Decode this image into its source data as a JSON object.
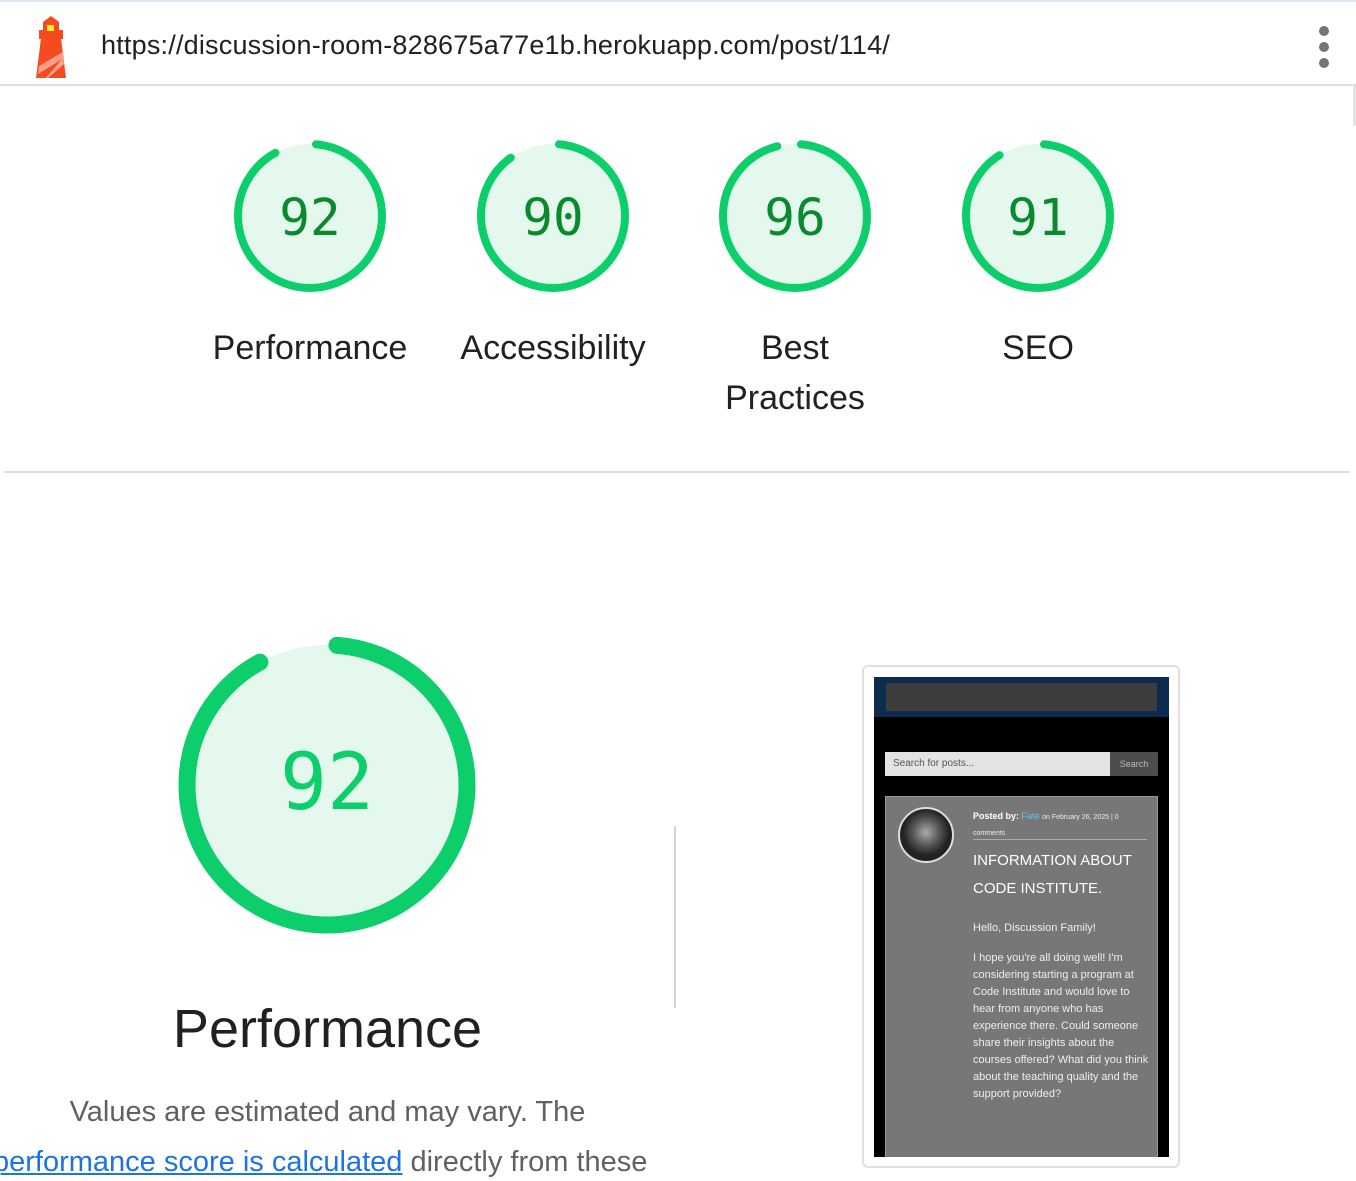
{
  "header": {
    "url": "https://discussion-room-828675a77e1b.herokuapp.com/post/114/"
  },
  "scores": [
    {
      "value": 92,
      "label": "Performance"
    },
    {
      "value": 90,
      "label": "Accessibility"
    },
    {
      "value": 96,
      "label": "Best Practices"
    },
    {
      "value": 91,
      "label": "SEO"
    }
  ],
  "main": {
    "score": 92,
    "title": "Performance",
    "desc_line1": "Values are estimated and may vary. The",
    "link_text": "performance score is calculated",
    "desc_tail": " directly from these"
  },
  "screenshot": {
    "search_placeholder": "Search for posts...",
    "search_button": "Search",
    "posted_by": "Posted by:",
    "author": "Fate",
    "date": "on February 26, 2025 | 0",
    "comments": "comments",
    "title": "INFORMATION ABOUT CODE INSTITUTE.",
    "greeting": "Hello, Discussion Family!",
    "body": "I hope you're all doing well! I'm considering starting a program at Code Institute and would love to hear from anyone who has experience there. Could someone share their insights about the courses offered? What did you think about the teaching quality and the support provided?"
  },
  "colors": {
    "pass_ring": "#0cce6b",
    "pass_fill": "#e5f8ed",
    "pass_text": "#0a8a2e",
    "link": "#1a73e8"
  },
  "icons": [
    "lighthouse-logo-icon",
    "more-vert-icon"
  ]
}
